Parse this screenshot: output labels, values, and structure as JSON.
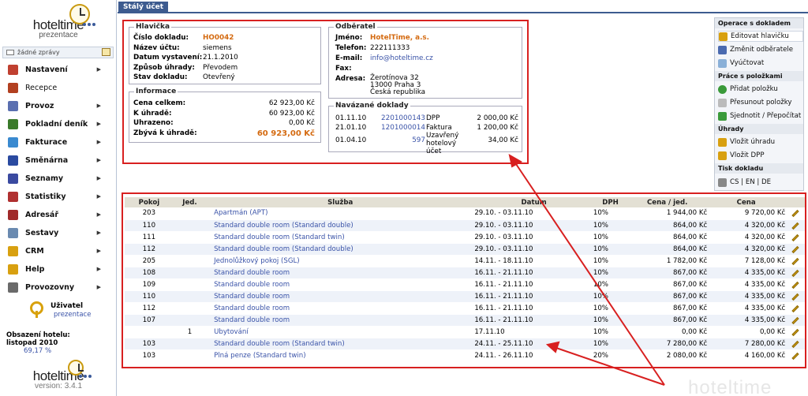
{
  "app": {
    "name": "hoteltime",
    "subtitle": "prezentace",
    "version": "version: 3.4.1"
  },
  "messages": {
    "text": "žádné zprávy"
  },
  "nav": [
    {
      "label": "Nastavení",
      "icon": "settings-icon",
      "color": "#c04030",
      "arrow": true,
      "bold": true
    },
    {
      "label": "Recepce",
      "icon": "reception-icon",
      "color": "#b24020",
      "arrow": false,
      "bold": false
    },
    {
      "label": "Provoz",
      "icon": "operations-icon",
      "color": "#5a6fb0",
      "arrow": true,
      "bold": true
    },
    {
      "label": "Pokladní deník",
      "icon": "cashbook-icon",
      "color": "#3a7a2a",
      "arrow": true,
      "bold": true
    },
    {
      "label": "Fakturace",
      "icon": "invoicing-icon",
      "color": "#3a8ad0",
      "arrow": true,
      "bold": true
    },
    {
      "label": "Směnárna",
      "icon": "exchange-icon",
      "color": "#2a4aa0",
      "arrow": true,
      "bold": true
    },
    {
      "label": "Seznamy",
      "icon": "lists-icon",
      "color": "#3a4aa0",
      "arrow": true,
      "bold": true
    },
    {
      "label": "Statistiky",
      "icon": "stats-icon",
      "color": "#b03030",
      "arrow": true,
      "bold": true
    },
    {
      "label": "Adresář",
      "icon": "addressbook-icon",
      "color": "#a02a2a",
      "arrow": true,
      "bold": true
    },
    {
      "label": "Sestavy",
      "icon": "reports-icon",
      "color": "#6a8ab0",
      "arrow": true,
      "bold": true
    },
    {
      "label": "CRM",
      "icon": "crm-icon",
      "color": "#d8a010",
      "arrow": true,
      "bold": true
    },
    {
      "label": "Help",
      "icon": "help-icon",
      "color": "#d8a010",
      "arrow": true,
      "bold": true
    },
    {
      "label": "Provozovny",
      "icon": "branches-icon",
      "color": "#6a6a6a",
      "arrow": true,
      "bold": true
    }
  ],
  "user": {
    "label": "Uživatel",
    "name": "prezentace"
  },
  "occupancy": {
    "title": "Obsazení hotelu:",
    "period": "listopad 2010",
    "value": "69,17 %"
  },
  "page": {
    "tab": "Stálý účet"
  },
  "header": {
    "legend": "Hlavička",
    "rows": [
      {
        "label": "Číslo dokladu:",
        "value": "HO0042",
        "accent": true
      },
      {
        "label": "Název účtu:",
        "value": "siemens",
        "accent": false
      },
      {
        "label": "Datum vystavení:",
        "value": "21.1.2010",
        "accent": false
      },
      {
        "label": "Způsob úhrady:",
        "value": "Převodem",
        "accent": false
      },
      {
        "label": "Stav dokladu:",
        "value": "Otevřený",
        "accent": false
      }
    ]
  },
  "info": {
    "legend": "Informace",
    "rows": [
      {
        "label": "Cena celkem:",
        "value": "62 923,00 Kč"
      },
      {
        "label": "K úhradě:",
        "value": "60 923,00 Kč"
      },
      {
        "label": "Uhrazeno:",
        "value": "0,00 Kč"
      },
      {
        "label": "Zbývá k úhradě:",
        "value": "60 923,00 Kč"
      }
    ]
  },
  "recipient": {
    "legend": "Odběratel",
    "name_label": "Jméno:",
    "name": "HotelTime, a.s.",
    "phone_label": "Telefon:",
    "phone": "222111333",
    "email_label": "E-mail:",
    "email": "info@hoteltime.cz",
    "fax_label": "Fax:",
    "address_label": "Adresa:",
    "address1": "Žerotínova 32",
    "address2": "13000 Praha 3",
    "address3": "Česká republika"
  },
  "linked": {
    "legend": "Navázané doklady",
    "rows": [
      {
        "date": "01.11.10",
        "number": "2201000143",
        "type": "DPP",
        "amount": "2 000,00 Kč"
      },
      {
        "date": "21.01.10",
        "number": "1201000014",
        "type": "Faktura",
        "amount": "1 200,00 Kč"
      },
      {
        "date": "01.04.10",
        "number": "597",
        "type": "Uzavřený hotelový účet",
        "amount": "34,00 Kč"
      }
    ]
  },
  "actions": {
    "doc_title": "Operace s dokladem",
    "edit_header": "Editovat hlavičku",
    "change_recipient": "Změnit odběratele",
    "settle": "Vyúčtovat",
    "items_title": "Práce s položkami",
    "add_item": "Přidat položku",
    "move_items": "Přesunout položky",
    "merge": "Sjednotit / Přepočítat",
    "pay_title": "Úhrady",
    "insert_payment": "Vložit úhradu",
    "insert_dpp": "Vložit DPP",
    "print_title": "Tisk dokladu",
    "langs": "CS | EN | DE"
  },
  "table": {
    "headers": [
      "Pokoj",
      "Jed.",
      "Služba",
      "Datum",
      "DPH",
      "Cena / jed.",
      "Cena"
    ],
    "rows": [
      {
        "room": "203",
        "unit": "",
        "service": "Apartmán (APT)",
        "date": "29.10. - 03.11.10",
        "vat": "10%",
        "unit_price": "1 944,00 Kč",
        "price": "9 720,00 Kč"
      },
      {
        "room": "110",
        "unit": "",
        "service": "Standard double room (Standard double)",
        "date": "29.10. - 03.11.10",
        "vat": "10%",
        "unit_price": "864,00 Kč",
        "price": "4 320,00 Kč"
      },
      {
        "room": "111",
        "unit": "",
        "service": "Standard double room (Standard twin)",
        "date": "29.10. - 03.11.10",
        "vat": "10%",
        "unit_price": "864,00 Kč",
        "price": "4 320,00 Kč"
      },
      {
        "room": "112",
        "unit": "",
        "service": "Standard double room (Standard double)",
        "date": "29.10. - 03.11.10",
        "vat": "10%",
        "unit_price": "864,00 Kč",
        "price": "4 320,00 Kč"
      },
      {
        "room": "205",
        "unit": "",
        "service": "Jednolůžkový pokoj (SGL)",
        "date": "14.11. - 18.11.10",
        "vat": "10%",
        "unit_price": "1 782,00 Kč",
        "price": "7 128,00 Kč"
      },
      {
        "room": "108",
        "unit": "",
        "service": "Standard double room",
        "date": "16.11. - 21.11.10",
        "vat": "10%",
        "unit_price": "867,00 Kč",
        "price": "4 335,00 Kč"
      },
      {
        "room": "109",
        "unit": "",
        "service": "Standard double room",
        "date": "16.11. - 21.11.10",
        "vat": "10%",
        "unit_price": "867,00 Kč",
        "price": "4 335,00 Kč"
      },
      {
        "room": "110",
        "unit": "",
        "service": "Standard double room",
        "date": "16.11. - 21.11.10",
        "vat": "10%",
        "unit_price": "867,00 Kč",
        "price": "4 335,00 Kč"
      },
      {
        "room": "112",
        "unit": "",
        "service": "Standard double room",
        "date": "16.11. - 21.11.10",
        "vat": "10%",
        "unit_price": "867,00 Kč",
        "price": "4 335,00 Kč"
      },
      {
        "room": "107",
        "unit": "",
        "service": "Standard double room",
        "date": "16.11. - 21.11.10",
        "vat": "10%",
        "unit_price": "867,00 Kč",
        "price": "4 335,00 Kč"
      },
      {
        "room": "",
        "unit": "1",
        "service": "Ubytování",
        "date": "17.11.10",
        "vat": "10%",
        "unit_price": "0,00 Kč",
        "price": "0,00 Kč"
      },
      {
        "room": "103",
        "unit": "",
        "service": "Standard double room (Standard twin)",
        "date": "24.11. - 25.11.10",
        "vat": "10%",
        "unit_price": "7 280,00 Kč",
        "price": "7 280,00 Kč"
      },
      {
        "room": "103",
        "unit": "",
        "service": "Plná penze (Standard twin)",
        "date": "24.11. - 26.11.10",
        "vat": "20%",
        "unit_price": "2 080,00 Kč",
        "price": "4 160,00 Kč"
      }
    ]
  },
  "watermark": "hoteltime",
  "colors": {
    "accent": "#3d5b8f",
    "highlight": "#d82020",
    "orange": "#d46a10",
    "link": "#3a53a8"
  }
}
